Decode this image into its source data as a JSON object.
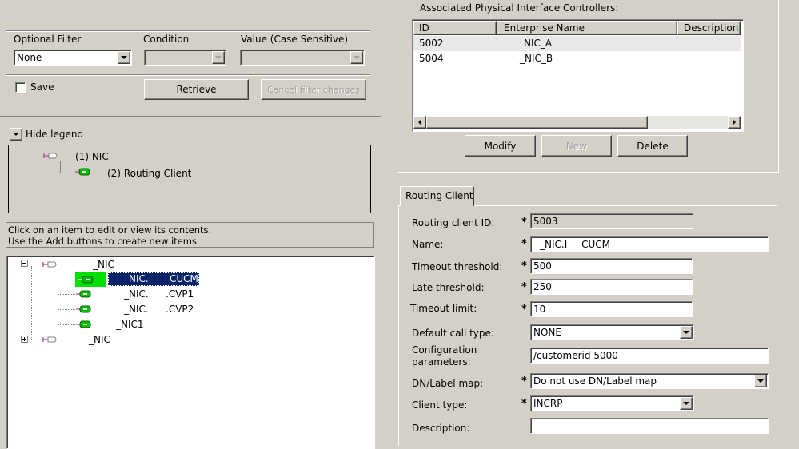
{
  "filter": {
    "optional_filter_label": "Optional Filter",
    "condition_label": "Condition",
    "value_label": "Value (Case Sensitive)",
    "optional_filter_value": "None",
    "save_label": "Save",
    "retrieve_label": "Retrieve",
    "cancel_label": "Cancel filter changes"
  },
  "legend": {
    "toggle_label": "Hide legend",
    "item1": "(1) NIC",
    "item2": "(2) Routing Client"
  },
  "help": {
    "line1": "Click on an item to edit or view its contents.",
    "line2": "Use the Add buttons to create new items."
  },
  "tree": {
    "root1": "_NIC",
    "child1": "_NIC.",
    "child1b": "CUCM",
    "child2a": "_NIC.",
    "child2b": ".CVP1",
    "child3a": "_NIC.",
    "child3b": ".CVP2",
    "child4": "_NIC1",
    "root2": "_NIC"
  },
  "pic": {
    "title": "Associated Physical Interface Controllers:",
    "columns": [
      "ID",
      "Enterprise Name",
      "Description"
    ],
    "rows": [
      {
        "id": "5002",
        "name": "NIC_A"
      },
      {
        "id": "5004",
        "name": "_NIC_B"
      }
    ],
    "modify_label": "Modify",
    "new_label": "New",
    "delete_label": "Delete"
  },
  "routing": {
    "tab_label": "Routing Client",
    "id_label": "Routing client ID:",
    "id_value": "5003",
    "name_label": "Name:",
    "name_value": "_NIC.I",
    "name_value2": "CUCM",
    "timeout_threshold_label": "Timeout threshold:",
    "timeout_threshold_value": "500",
    "late_threshold_label": "Late threshold:",
    "late_threshold_value": "250",
    "timeout_limit_label": "Timeout limit:",
    "timeout_limit_value": "10",
    "default_call_type_label": "Default call type:",
    "default_call_type_value": "NONE",
    "config_params_label1": "Configuration",
    "config_params_label2": "parameters:",
    "config_params_value": "/customerid 5000",
    "dn_label_map_label": "DN/Label map:",
    "dn_label_map_value": "Do not use DN/Label map",
    "client_type_label": "Client type:",
    "client_type_value": "INCRP",
    "description_label": "Description:",
    "description_value": "",
    "required_mark": "*"
  },
  "colors": {
    "face": "#d4d0c8",
    "selection": "#0a246a",
    "nic_icon": "#c060a0",
    "rc_icon": "#00a000",
    "highlight_green": "#00e000"
  }
}
